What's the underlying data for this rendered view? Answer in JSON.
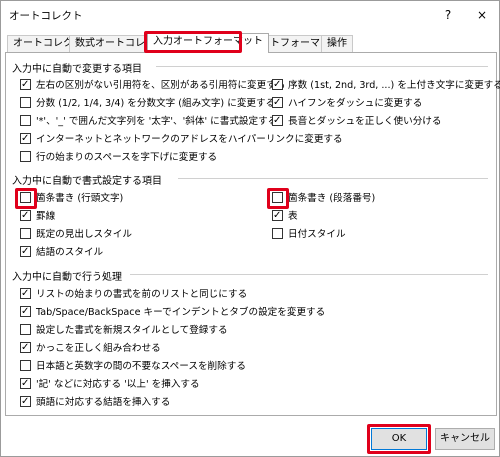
{
  "window": {
    "title": "オートコレクト",
    "help_glyph": "?",
    "close_glyph": "×"
  },
  "tabs": [
    {
      "label": "オートコレクト"
    },
    {
      "label": "数式オートコレクト"
    },
    {
      "label": "入力オートフォーマット",
      "active": true
    },
    {
      "label": "オートフォーマット"
    },
    {
      "label": "操作"
    }
  ],
  "section1": {
    "title": "入力中に自動で変更する項目",
    "left": [
      {
        "label": "左右の区別がない引用符を、区別がある引用符に変更する",
        "checked": true
      },
      {
        "label": "分数 (1/2, 1/4, 3/4) を分数文字 (組み文字) に変更する",
        "checked": false
      },
      {
        "label": "'*'、'_' で囲んだ文字列を '太字'、'斜体' に書式設定する",
        "checked": false
      },
      {
        "label": "インターネットとネットワークのアドレスをハイパーリンクに変更する",
        "checked": true
      },
      {
        "label": "行の始まりのスペースを字下げに変更する",
        "checked": false
      }
    ],
    "right": [
      {
        "label": "序数 (1st, 2nd, 3rd, ...) を上付き文字に変更する",
        "checked": true
      },
      {
        "label": "ハイフンをダッシュに変更する",
        "checked": true
      },
      {
        "label": "長音とダッシュを正しく使い分ける",
        "checked": true
      }
    ]
  },
  "section2": {
    "title": "入力中に自動で書式設定する項目",
    "left": [
      {
        "label": "箇条書き (行頭文字)",
        "checked": false
      },
      {
        "label": "罫線",
        "checked": true
      },
      {
        "label": "既定の見出しスタイル",
        "checked": false
      },
      {
        "label": "結語のスタイル",
        "checked": true
      }
    ],
    "right": [
      {
        "label": "箇条書き (段落番号)",
        "checked": false
      },
      {
        "label": "表",
        "checked": true
      },
      {
        "label": "日付スタイル",
        "checked": false
      }
    ]
  },
  "section3": {
    "title": "入力中に自動で行う処理",
    "items": [
      {
        "label": "リストの始まりの書式を前のリストと同じにする",
        "checked": true
      },
      {
        "label": "Tab/Space/BackSpace キーでインデントとタブの設定を変更する",
        "checked": true
      },
      {
        "label": "設定した書式を新規スタイルとして登録する",
        "checked": false
      },
      {
        "label": "かっこを正しく組み合わせる",
        "checked": true
      },
      {
        "label": "日本語と英数字の間の不要なスペースを削除する",
        "checked": false
      },
      {
        "label": "'記' などに対応する '以上' を挿入する",
        "checked": true
      },
      {
        "label": "頭語に対応する結語を挿入する",
        "checked": true
      }
    ]
  },
  "buttons": {
    "ok": "OK",
    "cancel": "キャンセル"
  },
  "colors": {
    "highlight": "#e0001b",
    "ok_border": "#0078d7"
  }
}
